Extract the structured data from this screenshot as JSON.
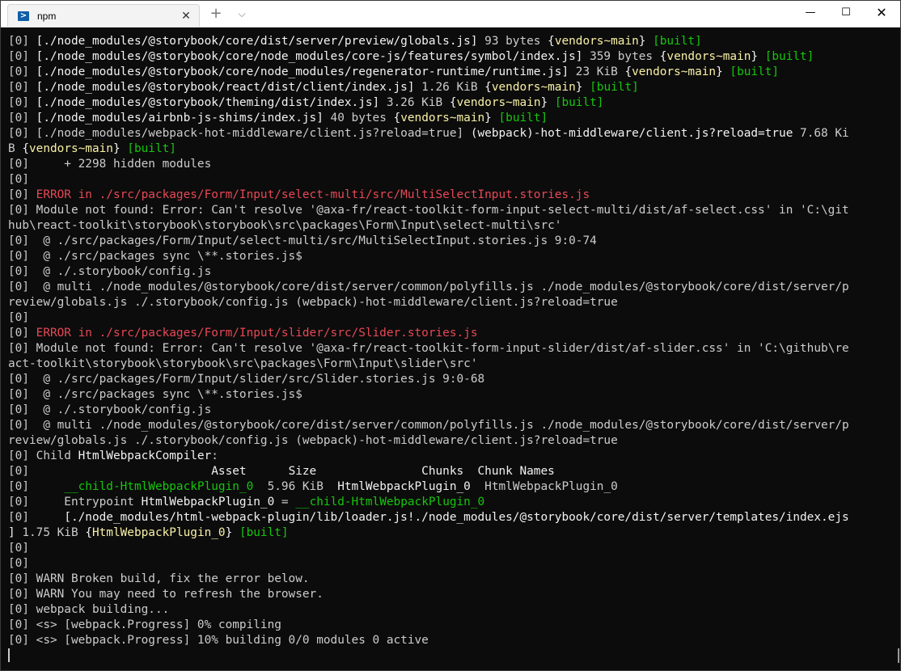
{
  "window": {
    "tab_title": "npm",
    "tab_close": "✕",
    "new_tab": "+",
    "tab_menu": "⌵",
    "minimize": "—",
    "maximize": "☐",
    "close": "✕"
  },
  "terminal": {
    "lines": [
      [
        [
          "p",
          "[0] "
        ],
        [
          "w",
          "[./node_modules/@storybook/core/dist/server/preview/globals.js] "
        ],
        [
          "p",
          "93 bytes "
        ],
        [
          "w",
          "{"
        ],
        [
          "y",
          "vendors~main"
        ],
        [
          "w",
          "} "
        ],
        [
          "g",
          "[built]"
        ]
      ],
      [
        [
          "p",
          "[0] "
        ],
        [
          "w",
          "[./node_modules/@storybook/core/node_modules/core-js/features/symbol/index.js] "
        ],
        [
          "p",
          "359 bytes "
        ],
        [
          "w",
          "{"
        ],
        [
          "y",
          "vendors~main"
        ],
        [
          "w",
          "} "
        ],
        [
          "g",
          "[built]"
        ]
      ],
      [
        [
          "p",
          "[0] "
        ],
        [
          "w",
          "[./node_modules/@storybook/core/node_modules/regenerator-runtime/runtime.js] "
        ],
        [
          "p",
          "23 KiB "
        ],
        [
          "w",
          "{"
        ],
        [
          "y",
          "vendors~main"
        ],
        [
          "w",
          "} "
        ],
        [
          "g",
          "[built]"
        ]
      ],
      [
        [
          "p",
          "[0] "
        ],
        [
          "w",
          "[./node_modules/@storybook/react/dist/client/index.js] "
        ],
        [
          "p",
          "1.26 KiB "
        ],
        [
          "w",
          "{"
        ],
        [
          "y",
          "vendors~main"
        ],
        [
          "w",
          "} "
        ],
        [
          "g",
          "[built]"
        ]
      ],
      [
        [
          "p",
          "[0] "
        ],
        [
          "w",
          "[./node_modules/@storybook/theming/dist/index.js] "
        ],
        [
          "p",
          "3.26 KiB "
        ],
        [
          "w",
          "{"
        ],
        [
          "y",
          "vendors~main"
        ],
        [
          "w",
          "} "
        ],
        [
          "g",
          "[built]"
        ]
      ],
      [
        [
          "p",
          "[0] "
        ],
        [
          "w",
          "[./node_modules/airbnb-js-shims/index.js] "
        ],
        [
          "p",
          "40 bytes "
        ],
        [
          "w",
          "{"
        ],
        [
          "y",
          "vendors~main"
        ],
        [
          "w",
          "} "
        ],
        [
          "g",
          "[built]"
        ]
      ],
      [
        [
          "p",
          "[0] "
        ],
        [
          "p",
          "[./node_modules/webpack-hot-middleware/client.js?reload=true] "
        ],
        [
          "w",
          "(webpack)-hot-middleware/client.js?reload=true "
        ],
        [
          "p",
          "7.68 Ki"
        ]
      ],
      [
        [
          "p",
          "B "
        ],
        [
          "w",
          "{"
        ],
        [
          "y",
          "vendors~main"
        ],
        [
          "w",
          "} "
        ],
        [
          "g",
          "[built]"
        ]
      ],
      [
        [
          "p",
          "[0]     + 2298 hidden modules"
        ]
      ],
      [
        [
          "p",
          "[0]"
        ]
      ],
      [
        [
          "p",
          "[0] "
        ],
        [
          "r",
          "ERROR in ./src/packages/Form/Input/select-multi/src/MultiSelectInput.stories.js"
        ]
      ],
      [
        [
          "p",
          "[0] Module not found: Error: Can't resolve '@axa-fr/react-toolkit-form-input-select-multi/dist/af-select.css' in 'C:\\git"
        ]
      ],
      [
        [
          "p",
          "hub\\react-toolkit\\storybook\\storybook\\src\\packages\\Form\\Input\\select-multi\\src'"
        ]
      ],
      [
        [
          "p",
          "[0]  @ ./src/packages/Form/Input/select-multi/src/MultiSelectInput.stories.js 9:0-74"
        ]
      ],
      [
        [
          "p",
          "[0]  @ ./src/packages sync \\**.stories.js$"
        ]
      ],
      [
        [
          "p",
          "[0]  @ ./.storybook/config.js"
        ]
      ],
      [
        [
          "p",
          "[0]  @ multi ./node_modules/@storybook/core/dist/server/common/polyfills.js ./node_modules/@storybook/core/dist/server/p"
        ]
      ],
      [
        [
          "p",
          "review/globals.js ./.storybook/config.js (webpack)-hot-middleware/client.js?reload=true"
        ]
      ],
      [
        [
          "p",
          "[0]"
        ]
      ],
      [
        [
          "p",
          "[0] "
        ],
        [
          "r",
          "ERROR in ./src/packages/Form/Input/slider/src/Slider.stories.js"
        ]
      ],
      [
        [
          "p",
          "[0] Module not found: Error: Can't resolve '@axa-fr/react-toolkit-form-input-slider/dist/af-slider.css' in 'C:\\github\\re"
        ]
      ],
      [
        [
          "p",
          "act-toolkit\\storybook\\storybook\\src\\packages\\Form\\Input\\slider\\src'"
        ]
      ],
      [
        [
          "p",
          "[0]  @ ./src/packages/Form/Input/slider/src/Slider.stories.js 9:0-68"
        ]
      ],
      [
        [
          "p",
          "[0]  @ ./src/packages sync \\**.stories.js$"
        ]
      ],
      [
        [
          "p",
          "[0]  @ ./.storybook/config.js"
        ]
      ],
      [
        [
          "p",
          "[0]  @ multi ./node_modules/@storybook/core/dist/server/common/polyfills.js ./node_modules/@storybook/core/dist/server/p"
        ]
      ],
      [
        [
          "p",
          "review/globals.js ./.storybook/config.js (webpack)-hot-middleware/client.js?reload=true"
        ]
      ],
      [
        [
          "p",
          "[0] Child "
        ],
        [
          "w",
          "HtmlWebpackCompiler"
        ],
        [
          "p",
          ":"
        ]
      ],
      [
        [
          "p",
          "[0]                          "
        ],
        [
          "w",
          "Asset      Size               Chunks  Chunk Names"
        ]
      ],
      [
        [
          "p",
          "[0]     "
        ],
        [
          "g",
          "__child-HtmlWebpackPlugin_0"
        ],
        [
          "p",
          "  5.96 KiB  "
        ],
        [
          "w",
          "HtmlWebpackPlugin_0"
        ],
        [
          "p",
          "  HtmlWebpackPlugin_0"
        ]
      ],
      [
        [
          "p",
          "[0]     Entrypoint "
        ],
        [
          "w",
          "HtmlWebpackPlugin_0"
        ],
        [
          "p",
          " = "
        ],
        [
          "g",
          "__child-HtmlWebpackPlugin_0"
        ]
      ],
      [
        [
          "p",
          "[0]     "
        ],
        [
          "w",
          "[./node_modules/html-webpack-plugin/lib/loader.js!./node_modules/@storybook/core/dist/server/templates/index.ejs"
        ]
      ],
      [
        [
          "w",
          "] "
        ],
        [
          "p",
          "1.75 KiB "
        ],
        [
          "w",
          "{"
        ],
        [
          "y",
          "HtmlWebpackPlugin_0"
        ],
        [
          "w",
          "} "
        ],
        [
          "g",
          "[built]"
        ]
      ],
      [
        [
          "p",
          "[0]"
        ]
      ],
      [
        [
          "p",
          "[0]"
        ]
      ],
      [
        [
          "p",
          "[0] WARN Broken build, fix the error below."
        ]
      ],
      [
        [
          "p",
          "[0] WARN You may need to refresh the browser."
        ]
      ],
      [
        [
          "p",
          "[0] webpack building..."
        ]
      ],
      [
        [
          "p",
          "[0] <s> [webpack.Progress] 0% compiling"
        ]
      ],
      [
        [
          "p",
          "[0] <s> [webpack.Progress] 10% building 0/0 modules 0 active"
        ]
      ]
    ]
  }
}
